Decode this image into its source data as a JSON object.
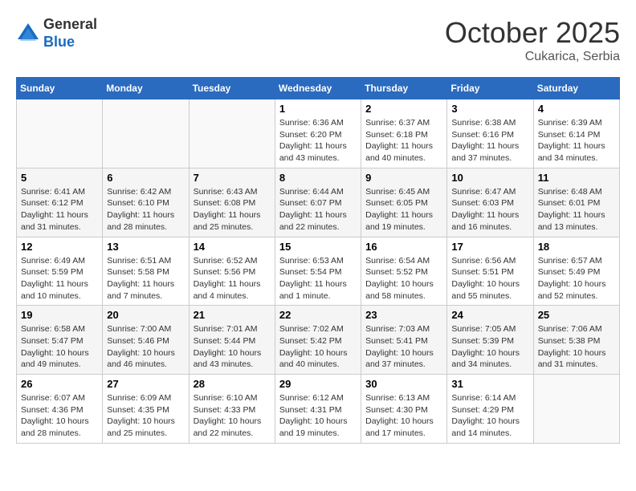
{
  "header": {
    "logo_general": "General",
    "logo_blue": "Blue",
    "month_title": "October 2025",
    "location": "Cukarica, Serbia"
  },
  "weekdays": [
    "Sunday",
    "Monday",
    "Tuesday",
    "Wednesday",
    "Thursday",
    "Friday",
    "Saturday"
  ],
  "weeks": [
    [
      {
        "day": "",
        "info": ""
      },
      {
        "day": "",
        "info": ""
      },
      {
        "day": "",
        "info": ""
      },
      {
        "day": "1",
        "info": "Sunrise: 6:36 AM\nSunset: 6:20 PM\nDaylight: 11 hours\nand 43 minutes."
      },
      {
        "day": "2",
        "info": "Sunrise: 6:37 AM\nSunset: 6:18 PM\nDaylight: 11 hours\nand 40 minutes."
      },
      {
        "day": "3",
        "info": "Sunrise: 6:38 AM\nSunset: 6:16 PM\nDaylight: 11 hours\nand 37 minutes."
      },
      {
        "day": "4",
        "info": "Sunrise: 6:39 AM\nSunset: 6:14 PM\nDaylight: 11 hours\nand 34 minutes."
      }
    ],
    [
      {
        "day": "5",
        "info": "Sunrise: 6:41 AM\nSunset: 6:12 PM\nDaylight: 11 hours\nand 31 minutes."
      },
      {
        "day": "6",
        "info": "Sunrise: 6:42 AM\nSunset: 6:10 PM\nDaylight: 11 hours\nand 28 minutes."
      },
      {
        "day": "7",
        "info": "Sunrise: 6:43 AM\nSunset: 6:08 PM\nDaylight: 11 hours\nand 25 minutes."
      },
      {
        "day": "8",
        "info": "Sunrise: 6:44 AM\nSunset: 6:07 PM\nDaylight: 11 hours\nand 22 minutes."
      },
      {
        "day": "9",
        "info": "Sunrise: 6:45 AM\nSunset: 6:05 PM\nDaylight: 11 hours\nand 19 minutes."
      },
      {
        "day": "10",
        "info": "Sunrise: 6:47 AM\nSunset: 6:03 PM\nDaylight: 11 hours\nand 16 minutes."
      },
      {
        "day": "11",
        "info": "Sunrise: 6:48 AM\nSunset: 6:01 PM\nDaylight: 11 hours\nand 13 minutes."
      }
    ],
    [
      {
        "day": "12",
        "info": "Sunrise: 6:49 AM\nSunset: 5:59 PM\nDaylight: 11 hours\nand 10 minutes."
      },
      {
        "day": "13",
        "info": "Sunrise: 6:51 AM\nSunset: 5:58 PM\nDaylight: 11 hours\nand 7 minutes."
      },
      {
        "day": "14",
        "info": "Sunrise: 6:52 AM\nSunset: 5:56 PM\nDaylight: 11 hours\nand 4 minutes."
      },
      {
        "day": "15",
        "info": "Sunrise: 6:53 AM\nSunset: 5:54 PM\nDaylight: 11 hours\nand 1 minute."
      },
      {
        "day": "16",
        "info": "Sunrise: 6:54 AM\nSunset: 5:52 PM\nDaylight: 10 hours\nand 58 minutes."
      },
      {
        "day": "17",
        "info": "Sunrise: 6:56 AM\nSunset: 5:51 PM\nDaylight: 10 hours\nand 55 minutes."
      },
      {
        "day": "18",
        "info": "Sunrise: 6:57 AM\nSunset: 5:49 PM\nDaylight: 10 hours\nand 52 minutes."
      }
    ],
    [
      {
        "day": "19",
        "info": "Sunrise: 6:58 AM\nSunset: 5:47 PM\nDaylight: 10 hours\nand 49 minutes."
      },
      {
        "day": "20",
        "info": "Sunrise: 7:00 AM\nSunset: 5:46 PM\nDaylight: 10 hours\nand 46 minutes."
      },
      {
        "day": "21",
        "info": "Sunrise: 7:01 AM\nSunset: 5:44 PM\nDaylight: 10 hours\nand 43 minutes."
      },
      {
        "day": "22",
        "info": "Sunrise: 7:02 AM\nSunset: 5:42 PM\nDaylight: 10 hours\nand 40 minutes."
      },
      {
        "day": "23",
        "info": "Sunrise: 7:03 AM\nSunset: 5:41 PM\nDaylight: 10 hours\nand 37 minutes."
      },
      {
        "day": "24",
        "info": "Sunrise: 7:05 AM\nSunset: 5:39 PM\nDaylight: 10 hours\nand 34 minutes."
      },
      {
        "day": "25",
        "info": "Sunrise: 7:06 AM\nSunset: 5:38 PM\nDaylight: 10 hours\nand 31 minutes."
      }
    ],
    [
      {
        "day": "26",
        "info": "Sunrise: 6:07 AM\nSunset: 4:36 PM\nDaylight: 10 hours\nand 28 minutes."
      },
      {
        "day": "27",
        "info": "Sunrise: 6:09 AM\nSunset: 4:35 PM\nDaylight: 10 hours\nand 25 minutes."
      },
      {
        "day": "28",
        "info": "Sunrise: 6:10 AM\nSunset: 4:33 PM\nDaylight: 10 hours\nand 22 minutes."
      },
      {
        "day": "29",
        "info": "Sunrise: 6:12 AM\nSunset: 4:31 PM\nDaylight: 10 hours\nand 19 minutes."
      },
      {
        "day": "30",
        "info": "Sunrise: 6:13 AM\nSunset: 4:30 PM\nDaylight: 10 hours\nand 17 minutes."
      },
      {
        "day": "31",
        "info": "Sunrise: 6:14 AM\nSunset: 4:29 PM\nDaylight: 10 hours\nand 14 minutes."
      },
      {
        "day": "",
        "info": ""
      }
    ]
  ]
}
